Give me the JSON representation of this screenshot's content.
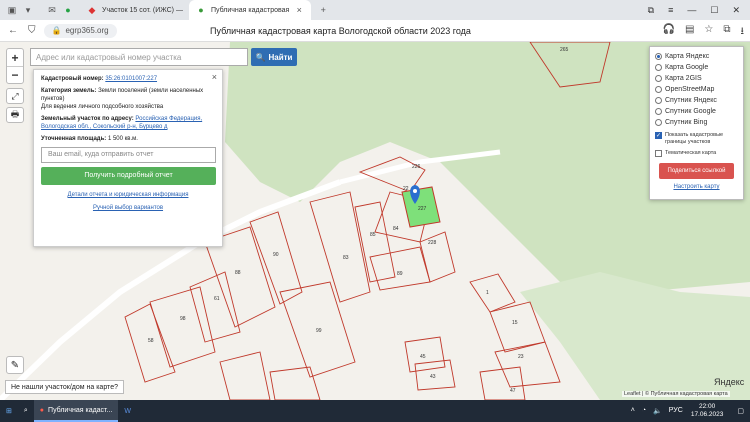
{
  "browser": {
    "tabs": [
      {
        "label": "Участок 15 сот. (ИЖС) —"
      },
      {
        "label": "Публичная кадастровая"
      }
    ],
    "url": "egrp365.org",
    "page_title": "Публичная кадастровая карта Вологодской области 2023 года"
  },
  "search": {
    "placeholder": "Адрес или кадастровый номер участка",
    "button_label": "Найти"
  },
  "info": {
    "cadastral_label": "Кадастровый номер:",
    "cadastral_value": "35:26:0101007:227",
    "category_label": "Категория земель:",
    "category_value": "Земли поселений (земли населенных пунктов)",
    "purpose": "Для ведения личного подсобного хозяйства",
    "address_label": "Земельный участок по адресу:",
    "address_value": "Российская Федерация, Вологодская обл., Сокольский р-н, Бурцево д",
    "area_label": "Уточненная площадь:",
    "area_value": "1 500 кв.м.",
    "email_placeholder": "Ваш email, куда отправить отчет",
    "get_report": "Получить подробный отчет",
    "details_link": "Детали отчета и юридическая информация",
    "manual_link": "Ручной выбор вариантов"
  },
  "layers": {
    "options": [
      {
        "label": "Карта Яндекс",
        "selected": true
      },
      {
        "label": "Карта Google",
        "selected": false
      },
      {
        "label": "Карта 2GIS",
        "selected": false
      },
      {
        "label": "OpenStreetMap",
        "selected": false
      },
      {
        "label": "Спутник Яндекс",
        "selected": false
      },
      {
        "label": "Спутник Google",
        "selected": false
      },
      {
        "label": "Спутник Bing",
        "selected": false
      }
    ],
    "show_borders": "Показать кадастровые границы участков",
    "thematic": "Тематическая карта",
    "share": "Поделиться ссылкой",
    "configure": "Настроить карту"
  },
  "map": {
    "parcel_labels": [
      "265",
      "226",
      "227",
      "228",
      "85",
      "84",
      "83",
      "89",
      "90",
      "88",
      "61",
      "98",
      "58",
      "99",
      "1",
      "15",
      "23",
      "45",
      "43",
      "47",
      "22"
    ],
    "not_found": "Не нашли участок/дом на карте?",
    "attribution": "Leaflet | © Публичная кадастровая карта",
    "yandex": "Яндекс",
    "colors": {
      "forest": "#cfe3c0",
      "parcel": "#c0392b",
      "selected": "#7ee07a"
    }
  },
  "taskbar": {
    "app_label": "Публичная кадаст...",
    "lang": "РУС",
    "time": "22:00",
    "date": "17.06.2023"
  }
}
